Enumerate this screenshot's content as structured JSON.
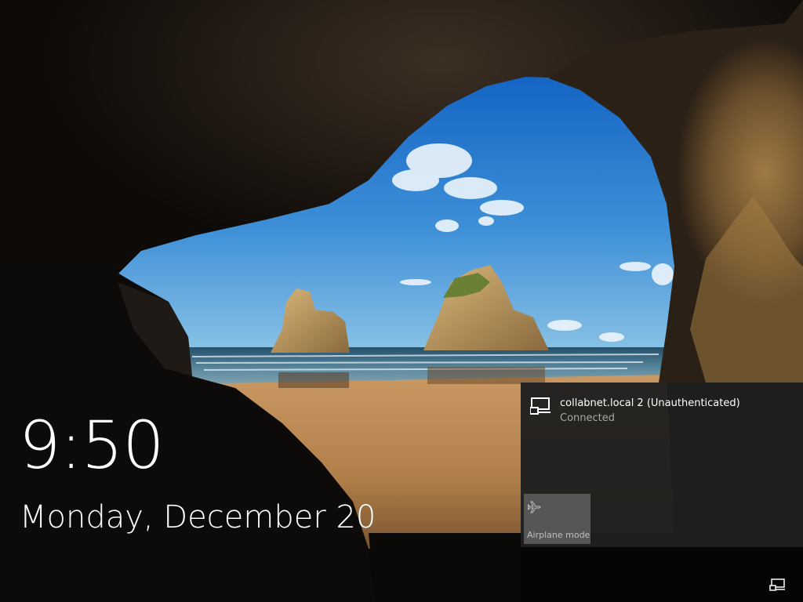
{
  "lockscreen": {
    "time": "9:50",
    "date": "Monday, December 20"
  },
  "network_flyout": {
    "network_name": "collabnet.local 2 (Unauthenticated)",
    "network_status": "Connected",
    "network_icon": "ethernet-icon",
    "quick_action": {
      "label": "Airplane mode",
      "icon": "airplane-icon",
      "state": "off"
    }
  },
  "tray": {
    "network_icon": "ethernet-icon"
  },
  "colors": {
    "flyout_bg": "#1f1f1f",
    "tile_bg": "#565656",
    "secondary_text": "#a6a6a6"
  }
}
